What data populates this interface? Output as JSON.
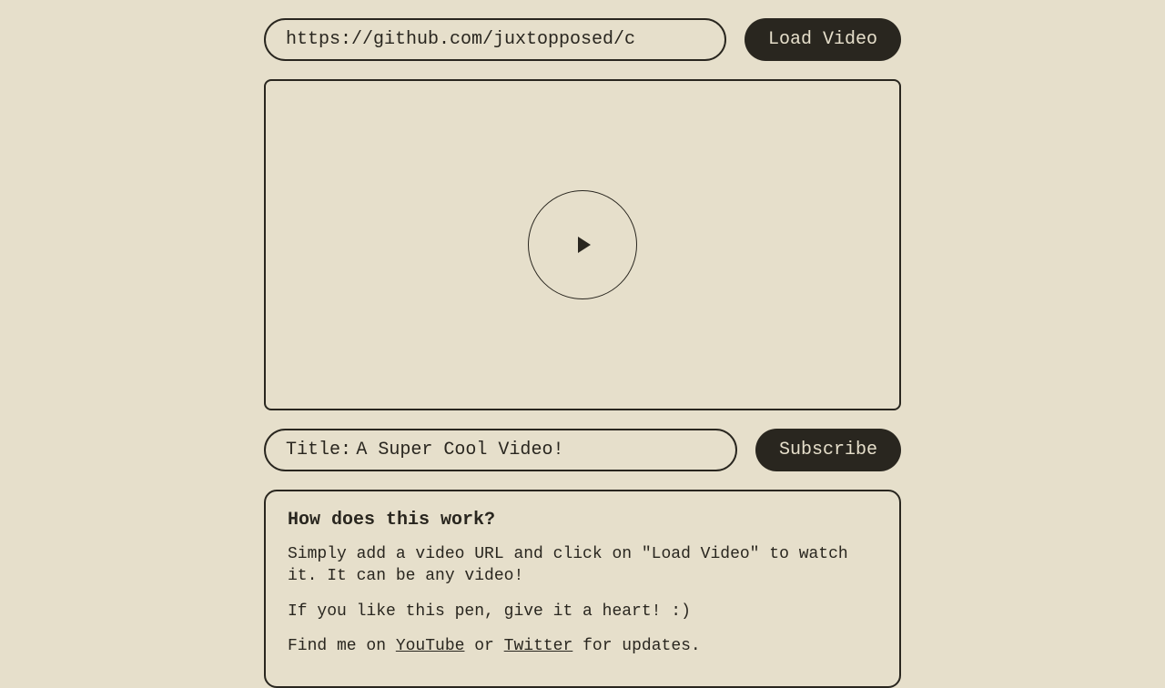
{
  "url_input": {
    "value": "https://github.com/juxtopposed/c"
  },
  "buttons": {
    "load": "Load Video",
    "subscribe": "Subscribe"
  },
  "title_row": {
    "prefix": "Title:",
    "title": "A Super Cool Video!"
  },
  "info": {
    "heading": "How does this work?",
    "p1": "Simply add a video URL and click on \"Load Video\" to watch it. It can be any video!",
    "p2": "If you like this pen, give it a heart! :)",
    "p3_pre": "Find me on ",
    "link1": "YouTube",
    "p3_mid": " or ",
    "link2": "Twitter",
    "p3_post": " for updates."
  }
}
